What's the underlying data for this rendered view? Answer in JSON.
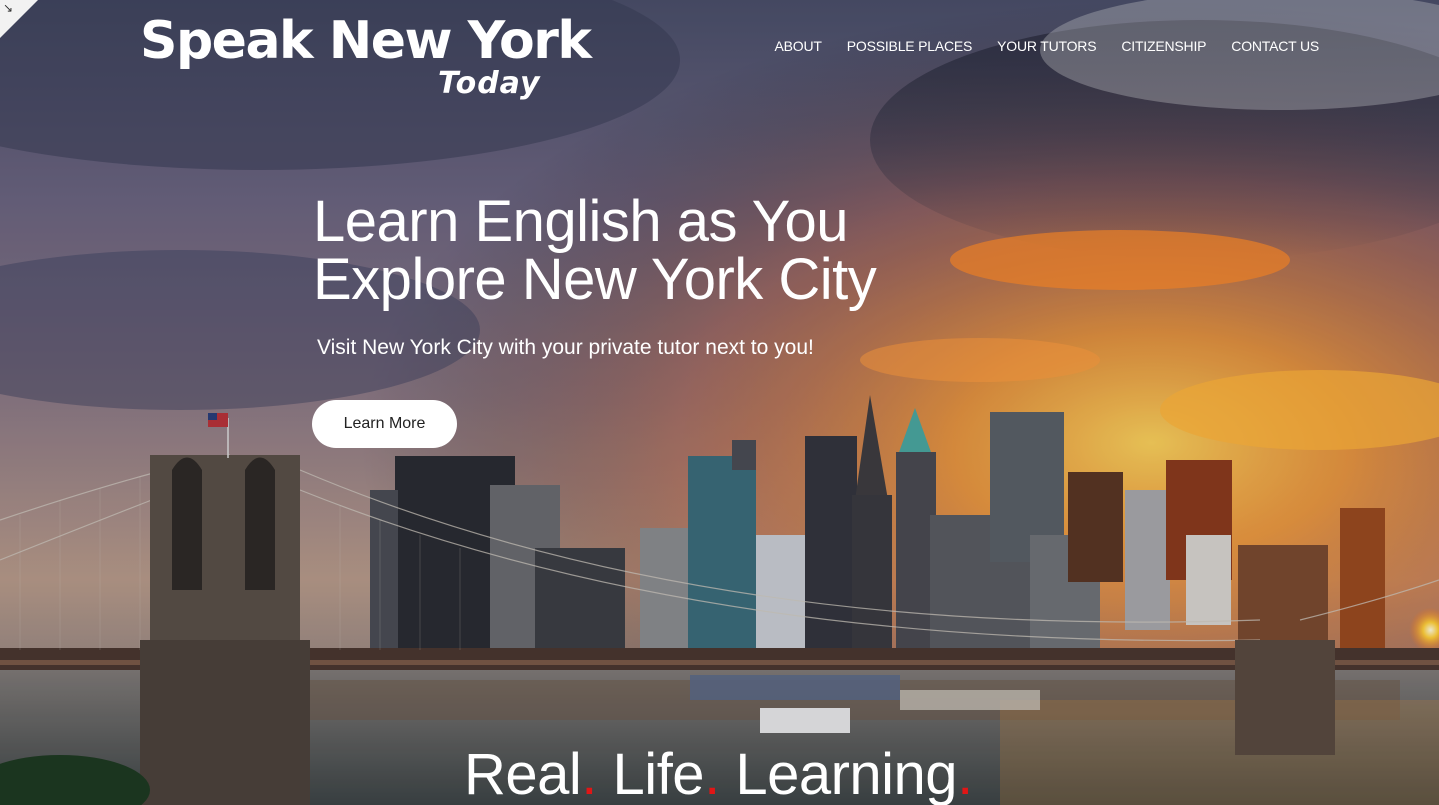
{
  "brand": {
    "name": "Speak New York",
    "sub": "Today"
  },
  "nav": {
    "items": [
      {
        "label": "ABOUT"
      },
      {
        "label": "POSSIBLE PLACES"
      },
      {
        "label": "YOUR TUTORS"
      },
      {
        "label": "CITIZENSHIP"
      },
      {
        "label": "CONTACT US"
      }
    ]
  },
  "hero": {
    "headline_line1": "Learn English as You",
    "headline_line2": "Explore New York City",
    "subheadline": "Visit New York City with your private tutor next to you!",
    "cta_label": "Learn More"
  },
  "tagline": {
    "words": [
      "Real",
      "Life",
      "Learning"
    ],
    "dot": "."
  },
  "colors": {
    "accent_dot": "#e01616",
    "cta_bg": "#ffffff",
    "text": "#ffffff"
  },
  "icons": {
    "corner": "resize-arrow-icon"
  }
}
